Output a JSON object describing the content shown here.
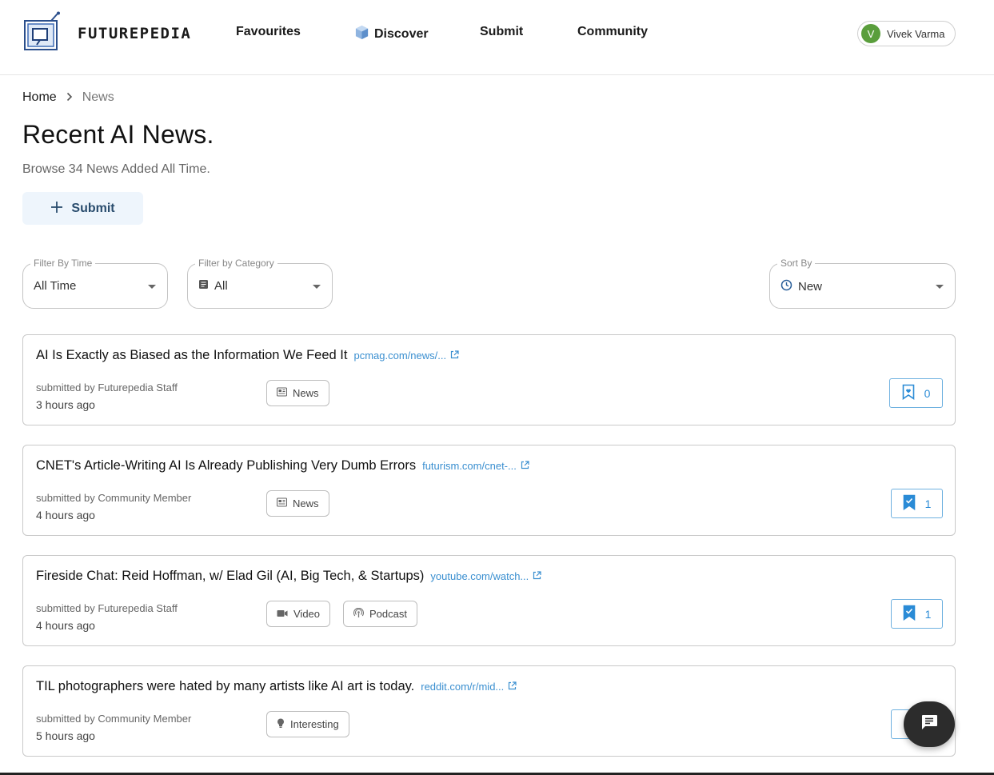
{
  "brand": {
    "name": "FUTUREPEDIA",
    "icon": "futurepedia-logo-icon"
  },
  "nav": {
    "favourites": "Favourites",
    "discover": "Discover",
    "discover_icon": "cube-icon",
    "submit": "Submit",
    "community": "Community"
  },
  "user": {
    "initial": "V",
    "name": "Vivek Varma",
    "avatar_color": "#5a9e3c"
  },
  "breadcrumb": {
    "home": "Home",
    "current": "News"
  },
  "page": {
    "title": "Recent AI News.",
    "subtitle": "Browse 34 News Added All Time.",
    "submit_label": "Submit"
  },
  "filters": {
    "time": {
      "label": "Filter By Time",
      "value": "All Time"
    },
    "category": {
      "label": "Filter by Category",
      "value": "All",
      "icon": "list-icon"
    },
    "sort": {
      "label": "Sort By",
      "value": "New",
      "icon": "clock-icon"
    }
  },
  "news": [
    {
      "title": "AI Is Exactly as Biased as the Information We Feed It",
      "link": "pcmag.com/news/...",
      "submitter": "submitted by Futurepedia Staff",
      "time": "3 hours ago",
      "tags": [
        {
          "label": "News",
          "icon": "newspaper-icon"
        }
      ],
      "favourites": "0",
      "favourited": false
    },
    {
      "title": "CNET's Article-Writing AI Is Already Publishing Very Dumb Errors",
      "link": "futurism.com/cnet-...",
      "submitter": "submitted by Community Member",
      "time": "4 hours ago",
      "tags": [
        {
          "label": "News",
          "icon": "newspaper-icon"
        }
      ],
      "favourites": "1",
      "favourited": true
    },
    {
      "title": "Fireside Chat: Reid Hoffman, w/ Elad Gil (AI, Big Tech, & Startups)",
      "link": "youtube.com/watch...",
      "submitter": "submitted by Futurepedia Staff",
      "time": "4 hours ago",
      "tags": [
        {
          "label": "Video",
          "icon": "video-camera-icon"
        },
        {
          "label": "Podcast",
          "icon": "podcast-icon"
        }
      ],
      "favourites": "1",
      "favourited": true
    },
    {
      "title": "TIL photographers were hated by many artists like AI art is today.",
      "link": "reddit.com/r/mid...",
      "submitter": "submitted by Community Member",
      "time": "5 hours ago",
      "tags": [
        {
          "label": "Interesting",
          "icon": "lightbulb-icon"
        }
      ],
      "favourites": "",
      "favourited": true
    }
  ],
  "colors": {
    "link": "#3a8fd0",
    "accent": "#2a8bd6",
    "submit_bg": "#eef5fc"
  }
}
